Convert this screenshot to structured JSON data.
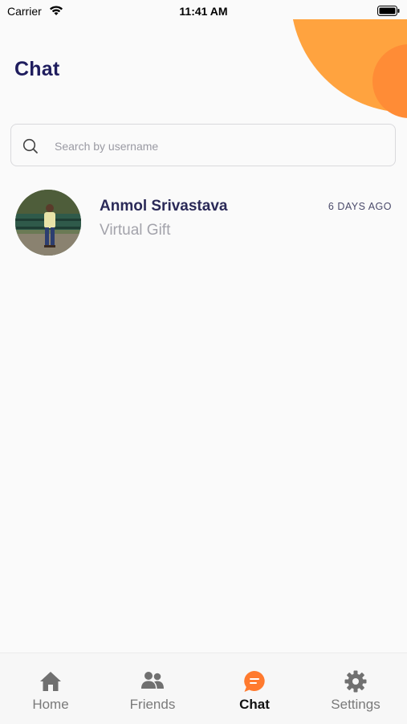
{
  "status_bar": {
    "carrier": "Carrier",
    "time": "11:41 AM"
  },
  "header": {
    "title": "Chat"
  },
  "search": {
    "placeholder": "Search by username",
    "value": ""
  },
  "chats": [
    {
      "name": "Anmol Srivastava",
      "preview": "Virtual Gift",
      "time": "6 DAYS AGO"
    }
  ],
  "tabs": [
    {
      "label": "Home",
      "icon": "home-icon",
      "active": false
    },
    {
      "label": "Friends",
      "icon": "friends-icon",
      "active": false
    },
    {
      "label": "Chat",
      "icon": "chat-icon",
      "active": true
    },
    {
      "label": "Settings",
      "icon": "gear-icon",
      "active": false
    }
  ],
  "colors": {
    "accent": "#ff8c36",
    "accent_light": "#ffa33f",
    "title": "#1f1d5e",
    "inactive": "#7a7a7a"
  }
}
